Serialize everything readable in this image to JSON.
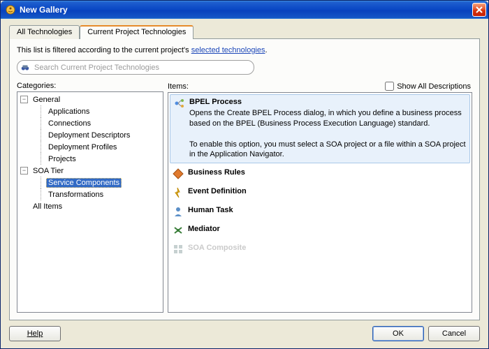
{
  "window": {
    "title": "New Gallery"
  },
  "tabs": {
    "all": "All Technologies",
    "current": "Current Project Technologies"
  },
  "filter": {
    "text_before": "This list is filtered according to the current project's ",
    "link": "selected technologies",
    "text_after": "."
  },
  "search": {
    "placeholder": "Search Current Project Technologies"
  },
  "categories": {
    "header": "Categories:",
    "items": [
      {
        "label": "General",
        "kind": "group",
        "expanded": true
      },
      {
        "label": "Applications",
        "kind": "child"
      },
      {
        "label": "Connections",
        "kind": "child"
      },
      {
        "label": "Deployment Descriptors",
        "kind": "child"
      },
      {
        "label": "Deployment Profiles",
        "kind": "child"
      },
      {
        "label": "Projects",
        "kind": "child"
      },
      {
        "label": "SOA Tier",
        "kind": "group",
        "expanded": true
      },
      {
        "label": "Service Components",
        "kind": "child",
        "selected": true
      },
      {
        "label": "Transformations",
        "kind": "child"
      },
      {
        "label": "All Items",
        "kind": "top"
      }
    ]
  },
  "items": {
    "header": "Items:",
    "show_all_label": "Show All Descriptions",
    "list": [
      {
        "name": "BPEL Process",
        "desc": "Opens the Create BPEL Process dialog, in which you define a business process based on the BPEL (Business Process Execution Language) standard.\n\nTo enable this option, you must select a SOA project or a file within a SOA project in the Application Navigator.",
        "selected": true,
        "disabled": false,
        "icon": "bpel-icon"
      },
      {
        "name": "Business Rules",
        "disabled": false,
        "icon": "rules-icon"
      },
      {
        "name": "Event Definition",
        "disabled": false,
        "icon": "event-icon"
      },
      {
        "name": "Human Task",
        "disabled": false,
        "icon": "human-task-icon"
      },
      {
        "name": "Mediator",
        "disabled": false,
        "icon": "mediator-icon"
      },
      {
        "name": "SOA Composite",
        "disabled": true,
        "icon": "composite-icon"
      }
    ]
  },
  "buttons": {
    "help": "Help",
    "ok": "OK",
    "cancel": "Cancel"
  }
}
